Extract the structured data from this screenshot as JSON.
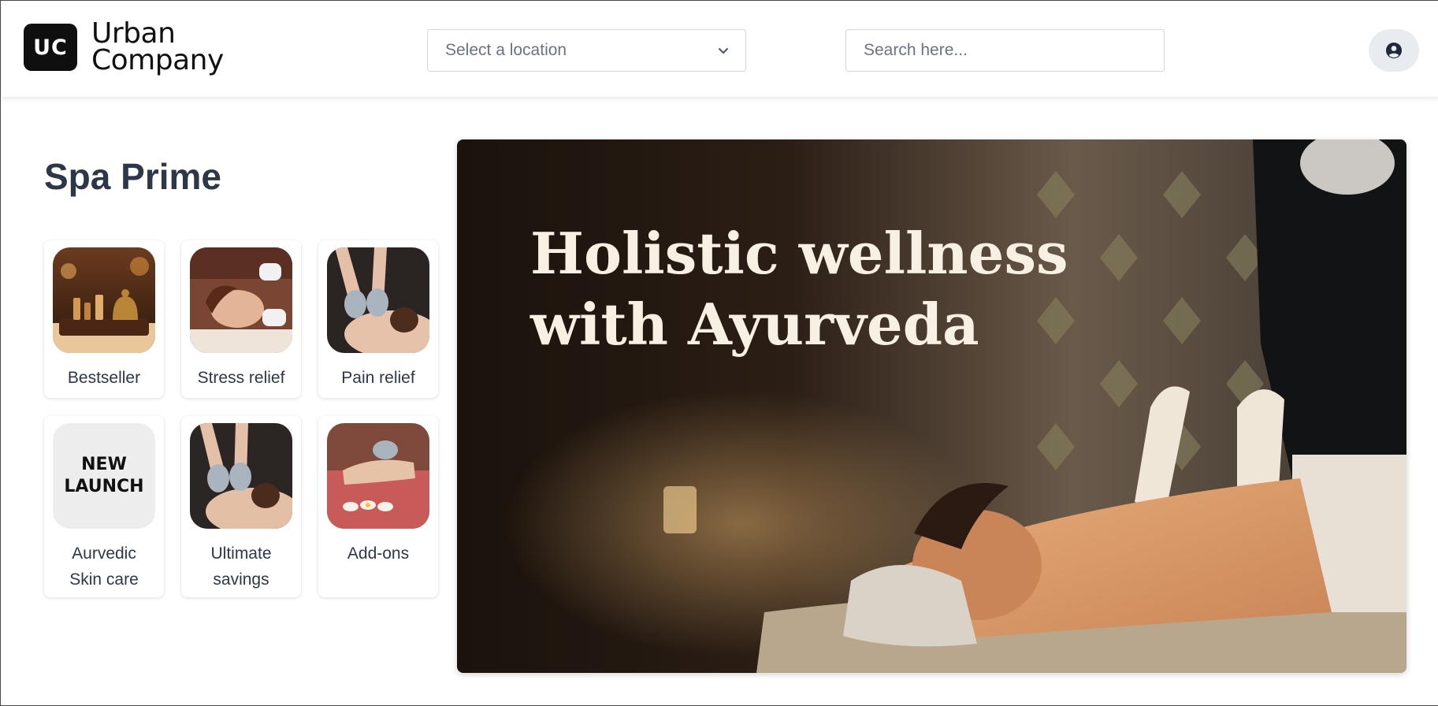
{
  "header": {
    "logo_mark": "UC",
    "logo_line1": "Urban",
    "logo_line2": "Company",
    "location_placeholder": "Select a location",
    "search_placeholder": "Search here..."
  },
  "main": {
    "title": "Spa Prime",
    "categories": [
      {
        "label": "Bestseller"
      },
      {
        "label": "Stress relief"
      },
      {
        "label": "Pain relief"
      },
      {
        "label": "Aurvedic Skin care",
        "line1": "Aurvedic",
        "line2": "Skin care",
        "badge_line1": "NEW",
        "badge_line2": "LAUNCH"
      },
      {
        "label": "Ultimate savings",
        "line1": "Ultimate",
        "line2": "savings"
      },
      {
        "label": "Add-ons"
      }
    ],
    "banner": {
      "line1": "Holistic wellness",
      "line2": "with Ayurveda"
    }
  },
  "icons": {
    "location_chevron": "chevron-down-icon",
    "avatar": "user-circle-icon"
  },
  "colors": {
    "title": "#2d3748",
    "banner_text": "#f7f0e3",
    "logo_bg": "#0f0f0f"
  }
}
